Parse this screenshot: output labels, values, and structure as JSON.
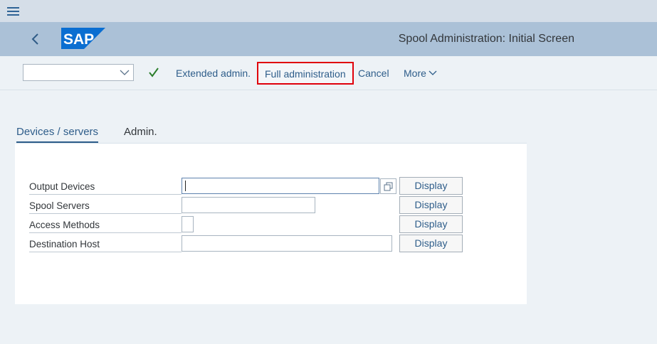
{
  "shell": {
    "title": "Spool Administration: Initial Screen",
    "logo_text": "SAP"
  },
  "toolbar": {
    "command_field_value": "",
    "extended_admin_label": "Extended admin.",
    "full_admin_label": "Full administration",
    "cancel_label": "Cancel",
    "more_label": "More"
  },
  "tabs": [
    {
      "label": "Devices / servers",
      "active": true
    },
    {
      "label": "Admin.",
      "active": false
    }
  ],
  "form": {
    "rows": [
      {
        "label": "Output Devices",
        "value": "",
        "button": "Display"
      },
      {
        "label": "Spool Servers",
        "value": "",
        "button": "Display"
      },
      {
        "label": "Access Methods",
        "value": "",
        "button": "Display"
      },
      {
        "label": "Destination Host",
        "value": "",
        "button": "Display"
      }
    ]
  },
  "colors": {
    "shell_background": "#abc1d7",
    "link_blue": "#2e5d8a",
    "highlight_red": "#e0000b",
    "sap_logo_blue": "#0a6ed1"
  },
  "icons": {
    "menu": "hamburger-icon",
    "back": "chevron-left-icon",
    "confirm": "checkmark-icon",
    "value_help": "value-help-icon",
    "more": "chevron-down-icon"
  }
}
